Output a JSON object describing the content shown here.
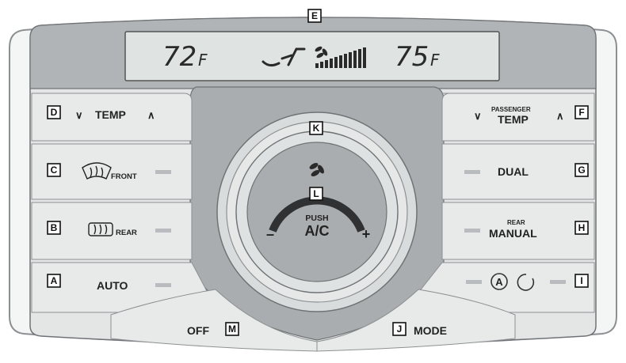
{
  "display": {
    "driver_temp": "72",
    "driver_unit": "F",
    "passenger_temp": "75",
    "passenger_unit": "F"
  },
  "buttons": {
    "temp_left": {
      "down": "∨",
      "label": "TEMP",
      "up": "∧"
    },
    "front_defrost": "FRONT",
    "rear_defrost": "REAR",
    "auto": "AUTO",
    "off": "OFF",
    "mode": "MODE",
    "passenger_temp": {
      "small": "PASSENGER",
      "label": "TEMP",
      "down": "∨",
      "up": "∧"
    },
    "dual": "DUAL",
    "rear_manual": {
      "small": "REAR",
      "label": "MANUAL"
    },
    "ac": {
      "push": "PUSH",
      "label": "A/C",
      "minus": "–",
      "plus": "+"
    },
    "recirc_auto": "A"
  },
  "callouts": {
    "A": "A",
    "B": "B",
    "C": "C",
    "D": "D",
    "E": "E",
    "F": "F",
    "G": "G",
    "H": "H",
    "I": "I",
    "J": "J",
    "K": "K",
    "L": "L",
    "M": "M"
  },
  "colors": {
    "panel_light": "#e4e6e6",
    "panel_dark": "#a9adaf",
    "lcd": "#dfe3e2",
    "indicator": "#b9bcbe"
  }
}
